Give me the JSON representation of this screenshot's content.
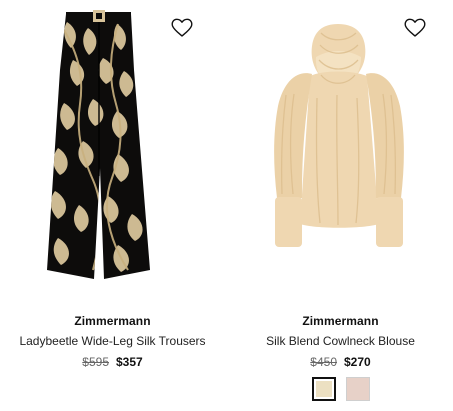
{
  "products": [
    {
      "brand": "Zimmermann",
      "name": "Ladybeetle Wide-Leg Silk Trousers",
      "original_price": "$595",
      "sale_price": "$357",
      "icon": "heart-outline-icon"
    },
    {
      "brand": "Zimmermann",
      "name": "Silk Blend Cowlneck Blouse",
      "original_price": "$450",
      "sale_price": "$270",
      "icon": "heart-outline-icon",
      "swatches": [
        {
          "color": "#ece0c2",
          "selected": true
        },
        {
          "color": "#e7d1c8",
          "selected": false
        }
      ]
    }
  ],
  "colors": {
    "trouser_base": "#0d0c0b",
    "trouser_print": "#d8c49a",
    "blouse_main": "#efd7b1",
    "blouse_shadow": "#ddbf8f"
  }
}
